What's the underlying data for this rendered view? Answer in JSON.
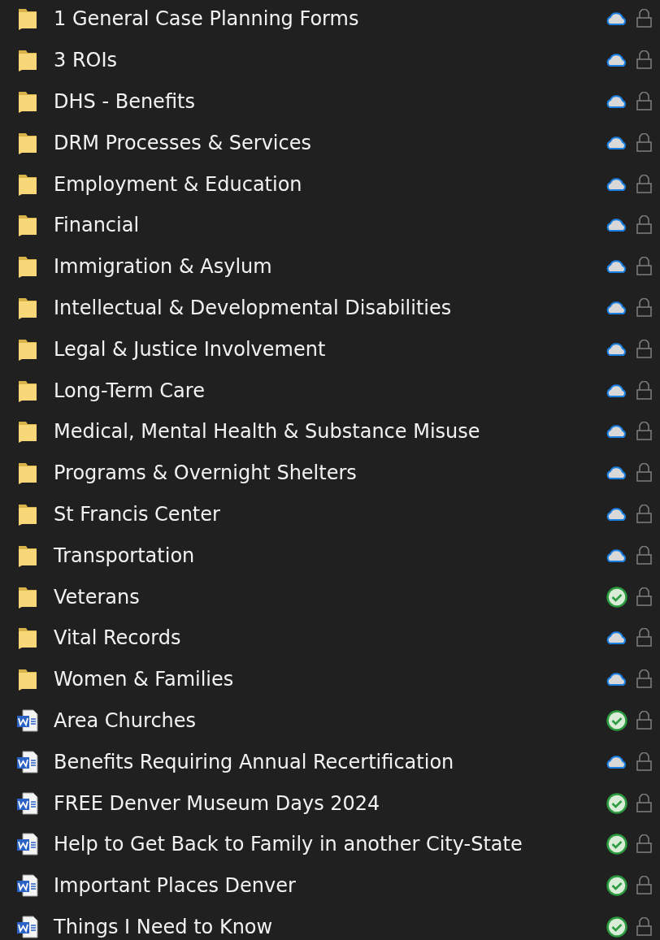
{
  "files": [
    {
      "name": "1 General Case Planning Forms",
      "kind": "folder",
      "available_offline": false
    },
    {
      "name": "3 ROIs",
      "kind": "folder",
      "available_offline": false
    },
    {
      "name": "DHS - Benefits",
      "kind": "folder",
      "available_offline": false
    },
    {
      "name": "DRM Processes & Services",
      "kind": "folder",
      "available_offline": false
    },
    {
      "name": "Employment & Education",
      "kind": "folder",
      "available_offline": false
    },
    {
      "name": "Financial",
      "kind": "folder",
      "available_offline": false
    },
    {
      "name": "Immigration & Asylum",
      "kind": "folder",
      "available_offline": false
    },
    {
      "name": "Intellectual & Developmental Disabilities",
      "kind": "folder",
      "available_offline": false
    },
    {
      "name": "Legal & Justice Involvement",
      "kind": "folder",
      "available_offline": false
    },
    {
      "name": "Long-Term Care",
      "kind": "folder",
      "available_offline": false
    },
    {
      "name": "Medical, Mental Health & Substance Misuse",
      "kind": "folder",
      "available_offline": false
    },
    {
      "name": "Programs & Overnight Shelters",
      "kind": "folder",
      "available_offline": false
    },
    {
      "name": "St Francis Center",
      "kind": "folder",
      "available_offline": false
    },
    {
      "name": "Transportation",
      "kind": "folder",
      "available_offline": false
    },
    {
      "name": "Veterans",
      "kind": "folder",
      "available_offline": true
    },
    {
      "name": "Vital Records",
      "kind": "folder",
      "available_offline": false
    },
    {
      "name": "Women & Families",
      "kind": "folder",
      "available_offline": false
    },
    {
      "name": "Area Churches",
      "kind": "document",
      "available_offline": true
    },
    {
      "name": "Benefits Requiring Annual Recertification",
      "kind": "document",
      "available_offline": false
    },
    {
      "name": "FREE Denver Museum Days 2024",
      "kind": "document",
      "available_offline": true
    },
    {
      "name": "Help to Get Back to Family in another City-State",
      "kind": "document",
      "available_offline": true
    },
    {
      "name": "Important Places Denver",
      "kind": "document",
      "available_offline": true
    },
    {
      "name": "Things I Need to Know",
      "kind": "document",
      "available_offline": true
    }
  ]
}
